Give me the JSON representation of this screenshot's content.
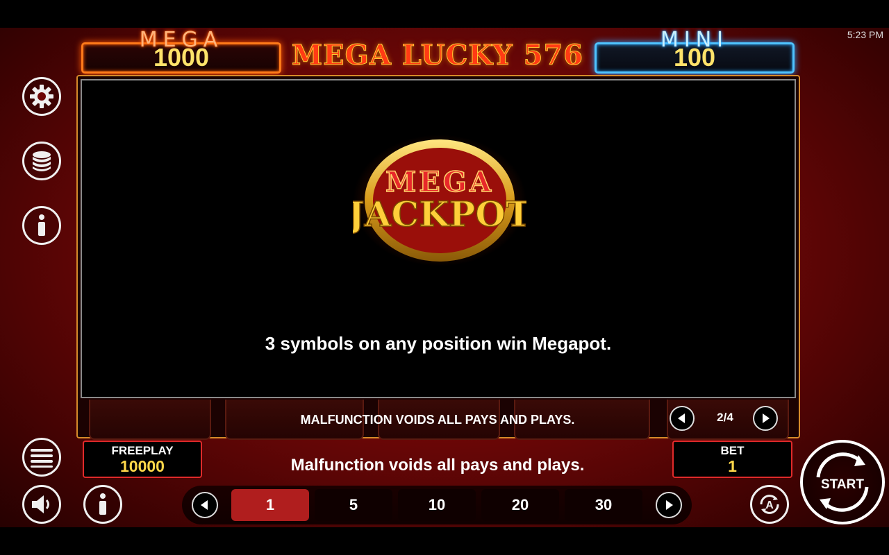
{
  "status_bar": {
    "time": "5:23 PM"
  },
  "jackpots": {
    "mega": {
      "label": "MEGA",
      "value": "1000"
    },
    "mini": {
      "label": "MINI",
      "value": "100"
    }
  },
  "game_title": "MEGA LUCKY 576",
  "left_menu": {
    "icons": [
      "gear-icon",
      "coin-stack-icon",
      "info-icon",
      "menu-icon",
      "speaker-icon"
    ]
  },
  "info_panel": {
    "logo": {
      "top": "MEGA",
      "bottom": "JACKPOT"
    },
    "description": "3 symbols on any position win Megapot."
  },
  "reel_footer": {
    "notice": "MALFUNCTION VOIDS ALL PAYS AND PLAYS.",
    "page_indicator": "2/4"
  },
  "freeplay": {
    "label": "FREEPLAY",
    "value": "10000"
  },
  "bottom_message": "Malfunction voids all pays and plays.",
  "bet": {
    "label": "BET",
    "value": "1"
  },
  "bet_options": [
    "1",
    "5",
    "10",
    "20",
    "30"
  ],
  "selected_bet_option": "1",
  "start_button": {
    "label": "START"
  },
  "colors": {
    "background": "#8b0c0c",
    "mega_frame": "#ff7a1a",
    "mini_frame": "#4fc3ff",
    "jackpot_value": "#ffe36a",
    "active_bet": "#b01e1e",
    "stat_border": "#e02a2a"
  }
}
